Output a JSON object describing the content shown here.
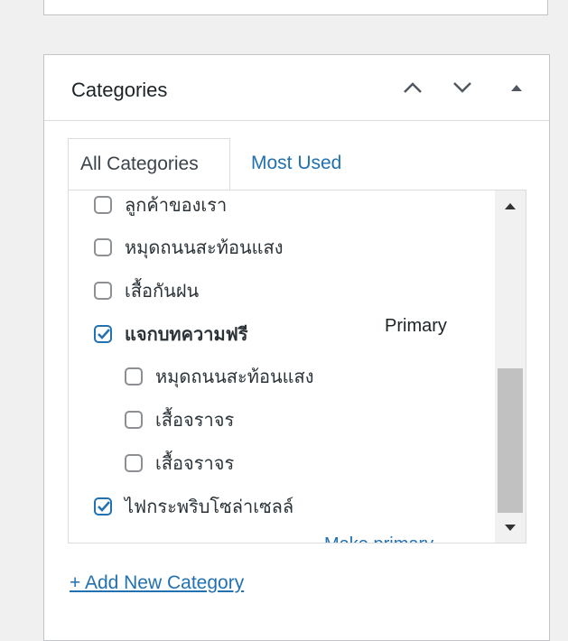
{
  "panel": {
    "title": "Categories",
    "tabs": {
      "all": "All Categories",
      "most_used": "Most Used"
    },
    "categories": [
      {
        "label": "ลูกค้าของเรา",
        "checked": false
      },
      {
        "label": "หมุดถนนสะท้อนแสง",
        "checked": false
      },
      {
        "label": "เสื้อกันฝน",
        "checked": false
      },
      {
        "label": "แจกบทความฟรี",
        "checked": true,
        "primary_text": "Primary"
      },
      {
        "label": "หมุดถนนสะท้อนแสง",
        "checked": false
      },
      {
        "label": "เสื้อจราจร",
        "checked": false
      },
      {
        "label": "เสื้อจราจร",
        "checked": false
      },
      {
        "label": "ไฟกระพริบโซล่าเซลล์",
        "checked": true,
        "make_primary_text": "Make primary"
      }
    ],
    "add_new": "+ Add New Category"
  },
  "colors": {
    "accent": "#2271b1",
    "border": "#c3c4c7",
    "background": "#f0f0f1"
  }
}
